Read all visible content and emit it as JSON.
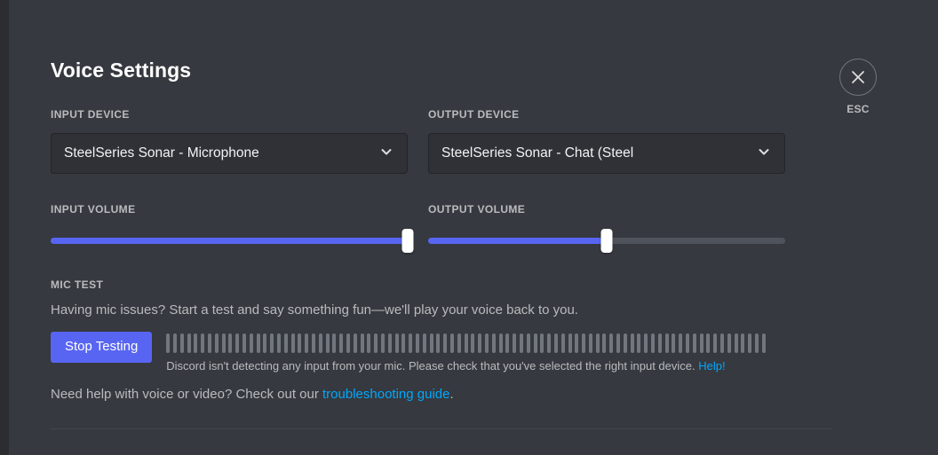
{
  "page_title": "Voice Settings",
  "close": {
    "icon": "close-icon",
    "label": "ESC"
  },
  "input_device": {
    "label": "INPUT DEVICE",
    "value": "SteelSeries Sonar - Microphone",
    "chevron_icon": "chevron-down-icon"
  },
  "output_device": {
    "label": "OUTPUT DEVICE",
    "value": "SteelSeries Sonar - Chat (Steel",
    "chevron_icon": "chevron-down-icon"
  },
  "input_volume": {
    "label": "INPUT VOLUME",
    "percent": 100
  },
  "output_volume": {
    "label": "OUTPUT VOLUME",
    "percent": 50
  },
  "mic_test": {
    "label": "MIC TEST",
    "description": "Having mic issues? Start a test and say something fun—we'll play your voice back to you.",
    "button_label": "Stop Testing",
    "meter_bars": 87,
    "warning_text": "Discord isn't detecting any input from your mic. Please check that you've selected the right input device.",
    "warning_link": "Help!"
  },
  "footer": {
    "text_before": "Need help with voice or video? Check out our ",
    "link": "troubleshooting guide",
    "text_after": "."
  },
  "colors": {
    "background": "#36393f",
    "accent": "#5865f2",
    "link": "#00a8fc",
    "track": "#4f545c",
    "meter_bar": "#72767d"
  }
}
